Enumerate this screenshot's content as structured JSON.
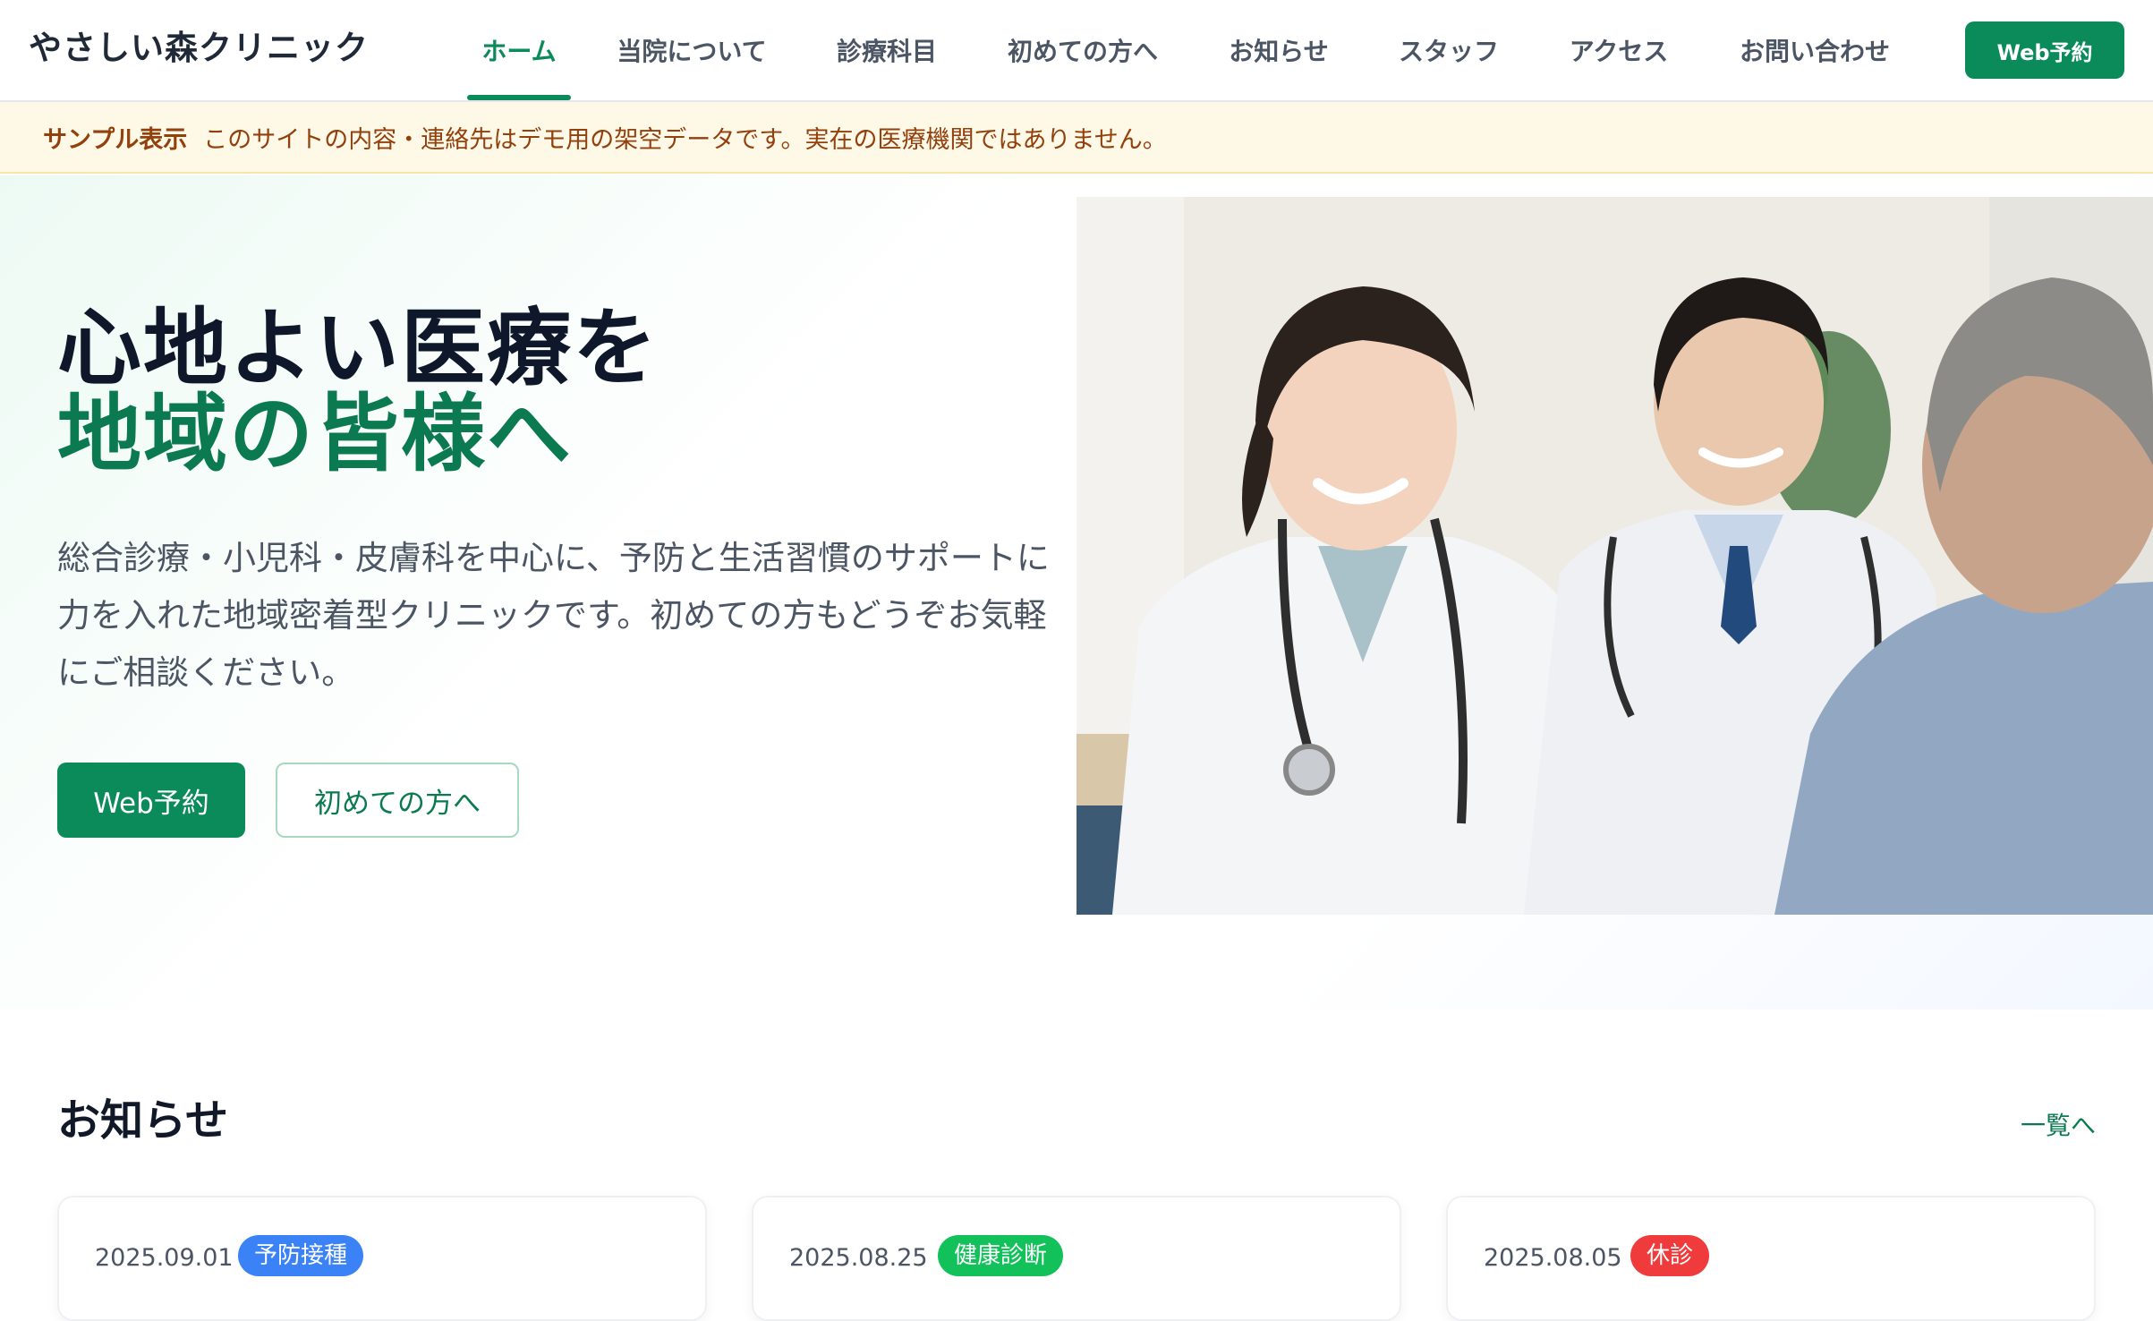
{
  "header": {
    "logo": "やさしい森クリニック",
    "nav": [
      {
        "label": "ホーム",
        "active": true
      },
      {
        "label": "当院について",
        "active": false
      },
      {
        "label": "診療科目",
        "active": false
      },
      {
        "label": "初めての方へ",
        "active": false
      },
      {
        "label": "お知らせ",
        "active": false
      },
      {
        "label": "スタッフ",
        "active": false
      },
      {
        "label": "アクセス",
        "active": false
      },
      {
        "label": "お問い合わせ",
        "active": false
      }
    ],
    "cta_label": "Web予約"
  },
  "banner": {
    "tag": "サンプル表示",
    "text": "このサイトの内容・連絡先はデモ用の架空データです。実在の医療機関ではありません。"
  },
  "hero": {
    "title_line1": "心地よい医療を",
    "title_line2": "地域の皆様へ",
    "description": "総合診療・小児科・皮膚科を中心に、予防と生活習慣のサポートに力を入れた地域密着型クリニックです。初めての方もどうぞお気軽にご相談ください。",
    "primary_button": "Web予約",
    "secondary_button": "初めての方へ"
  },
  "news": {
    "title": "お知らせ",
    "more_label": "一覧へ",
    "items": [
      {
        "date": "2025.09.01",
        "tag": "予防接種",
        "tag_color": "#3b82f6"
      },
      {
        "date": "2025.08.25",
        "tag": "健康診断",
        "tag_color": "#12c15a"
      },
      {
        "date": "2025.08.05",
        "tag": "休診",
        "tag_color": "#ef3b3b"
      }
    ]
  },
  "colors": {
    "brand": "#0b8a5a",
    "brand_text": "#0b7a50",
    "banner_bg": "#fef9e7",
    "banner_text": "#92400e"
  }
}
